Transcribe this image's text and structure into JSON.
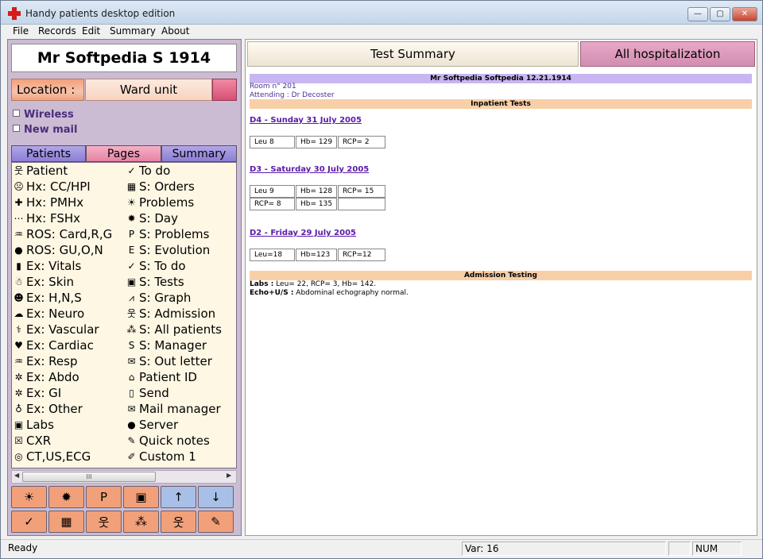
{
  "window": {
    "title": "Handy patients desktop edition",
    "min_label": "—",
    "max_label": "▢",
    "close_label": "✕"
  },
  "menu": [
    "File",
    "Records",
    "Edit",
    "Summary",
    "About"
  ],
  "left": {
    "patient_name": "Mr Softpedia S 1914",
    "location_label": "Location :",
    "location_value": "Ward unit",
    "checkboxes": [
      "Wireless",
      "New mail"
    ],
    "tabs": [
      "Patients",
      "Pages",
      "Summary"
    ],
    "nav_left": [
      {
        "label": "Patient",
        "icon": "stethoscope-icon",
        "glyph": "웃"
      },
      {
        "label": "Hx: CC/HPI",
        "icon": "sad-face-icon",
        "glyph": "☹"
      },
      {
        "label": "Hx: PMHx",
        "icon": "red-cross-icon",
        "glyph": "✚"
      },
      {
        "label": "Hx: FSHx",
        "icon": "family-tree-icon",
        "glyph": "⋯"
      },
      {
        "label": "ROS: Card,R,G",
        "icon": "lungs-icon",
        "glyph": "♒"
      },
      {
        "label": "ROS: GU,O,N",
        "icon": "brain-icon",
        "glyph": "●"
      },
      {
        "label": "Ex: Vitals",
        "icon": "thermometer-icon",
        "glyph": "▮"
      },
      {
        "label": "Ex: Skin",
        "icon": "body-icon",
        "glyph": "☃"
      },
      {
        "label": "Ex: H,N,S",
        "icon": "head-icon",
        "glyph": "☻"
      },
      {
        "label": "Ex: Neuro",
        "icon": "neuro-icon",
        "glyph": "☁"
      },
      {
        "label": "Ex: Vascular",
        "icon": "vascular-icon",
        "glyph": "⚕"
      },
      {
        "label": "Ex: Cardiac",
        "icon": "heart-icon",
        "glyph": "♥"
      },
      {
        "label": "Ex: Resp",
        "icon": "lungs-icon",
        "glyph": "♒"
      },
      {
        "label": "Ex: Abdo",
        "icon": "abdomen-icon",
        "glyph": "✲"
      },
      {
        "label": "Ex: GI",
        "icon": "gi-icon",
        "glyph": "✲"
      },
      {
        "label": "Ex: Other",
        "icon": "bone-icon",
        "glyph": "♁"
      },
      {
        "label": "Labs",
        "icon": "microscope-icon",
        "glyph": "▣"
      },
      {
        "label": "CXR",
        "icon": "xray-icon",
        "glyph": "☒"
      },
      {
        "label": "CT,US,ECG",
        "icon": "scanner-icon",
        "glyph": "◎"
      }
    ],
    "nav_right": [
      {
        "label": "To do",
        "icon": "checkmark-icon",
        "glyph": "✓"
      },
      {
        "label": "S: Orders",
        "icon": "orders-grid-icon",
        "glyph": "▦"
      },
      {
        "label": "Problems",
        "icon": "sun-icon",
        "glyph": "☀"
      },
      {
        "label": "S: Day",
        "icon": "day-icon",
        "glyph": "✹"
      },
      {
        "label": "S: Problems",
        "icon": "p-doc-icon",
        "glyph": "P"
      },
      {
        "label": "S: Evolution",
        "icon": "e-doc-icon",
        "glyph": "E"
      },
      {
        "label": "S: To do",
        "icon": "todo-check-icon",
        "glyph": "✓"
      },
      {
        "label": "S: Tests",
        "icon": "microscope-icon",
        "glyph": "▣"
      },
      {
        "label": "S: Graph",
        "icon": "graph-icon",
        "glyph": "⩘"
      },
      {
        "label": "S: Admission",
        "icon": "admission-icon",
        "glyph": "웃"
      },
      {
        "label": "S: All patients",
        "icon": "all-patients-icon",
        "glyph": "⁂"
      },
      {
        "label": "S: Manager",
        "icon": "manager-icon",
        "glyph": "S"
      },
      {
        "label": "S: Out letter",
        "icon": "envelope-icon",
        "glyph": "✉"
      },
      {
        "label": "Patient ID",
        "icon": "house-icon",
        "glyph": "⌂"
      },
      {
        "label": "Send",
        "icon": "phone-icon",
        "glyph": "▯"
      },
      {
        "label": "Mail manager",
        "icon": "mail-icon",
        "glyph": "✉"
      },
      {
        "label": "Server",
        "icon": "globe-icon",
        "glyph": "●"
      },
      {
        "label": "Quick notes",
        "icon": "notes-icon",
        "glyph": "✎"
      },
      {
        "label": "Custom 1",
        "icon": "pencil-icon",
        "glyph": "✐"
      }
    ],
    "scroll_thumb": "III",
    "toolbar": [
      {
        "icon": "sun-icon",
        "glyph": "☀",
        "bg": "#f2a079"
      },
      {
        "icon": "day-icon",
        "glyph": "✹",
        "bg": "#f2a079"
      },
      {
        "icon": "p-doc-icon",
        "glyph": "P",
        "bg": "#f2a079"
      },
      {
        "icon": "microscope-icon",
        "glyph": "▣",
        "bg": "#f2a079"
      },
      {
        "icon": "arrow-up-icon",
        "glyph": "↑",
        "bg": "#a8c0e8"
      },
      {
        "icon": "arrow-down-icon",
        "glyph": "↓",
        "bg": "#a8c0e8"
      },
      {
        "icon": "checkmark-icon",
        "glyph": "✓",
        "bg": "#f2a079"
      },
      {
        "icon": "orders-grid-icon",
        "glyph": "▦",
        "bg": "#f2a079"
      },
      {
        "icon": "admission-icon",
        "glyph": "웃",
        "bg": "#f2a079"
      },
      {
        "icon": "all-patients-icon",
        "glyph": "⁂",
        "bg": "#f2a079"
      },
      {
        "icon": "stethoscope-icon",
        "glyph": "웃",
        "bg": "#f2a079"
      },
      {
        "icon": "notes-icon",
        "glyph": "✎",
        "bg": "#f2a079"
      }
    ]
  },
  "right": {
    "tab_summary": "Test Summary",
    "tab_hosp": "All hospitalization",
    "header": "Mr Softpedia Softpedia 12.21.1914",
    "room": "Room n° 201",
    "attending": "Attending : Dr Decoster",
    "inpatient_title": "Inpatient Tests",
    "days": [
      {
        "date": "D4 - Sunday 31 July 2005",
        "rows": [
          [
            "Leu 8",
            "Hb= 129",
            "RCP= 2"
          ]
        ]
      },
      {
        "date": "D3 - Saturday 30 July 2005",
        "rows": [
          [
            "Leu 9",
            "Hb= 128",
            "RCP= 15"
          ],
          [
            "RCP= 8",
            "Hb= 135",
            ""
          ]
        ]
      },
      {
        "date": "D2 - Friday 29 July 2005",
        "rows": [
          [
            "Leu=18",
            "Hb=123",
            "RCP=12"
          ]
        ]
      }
    ],
    "admission_title": "Admission Testing",
    "labs_label": "Labs :",
    "labs_value": " Leu= 22, RCP= 3, Hb= 142.",
    "echo_label": "Echo+U/S :",
    "echo_value": " Abdominal echography normal."
  },
  "status": {
    "ready": "Ready",
    "var": "Var: 16",
    "num": "NUM"
  },
  "colors": {
    "purple_bar": "#c8b6f2",
    "orange_bar": "#f9cfa8",
    "left_panel": "#cbbcd4"
  }
}
